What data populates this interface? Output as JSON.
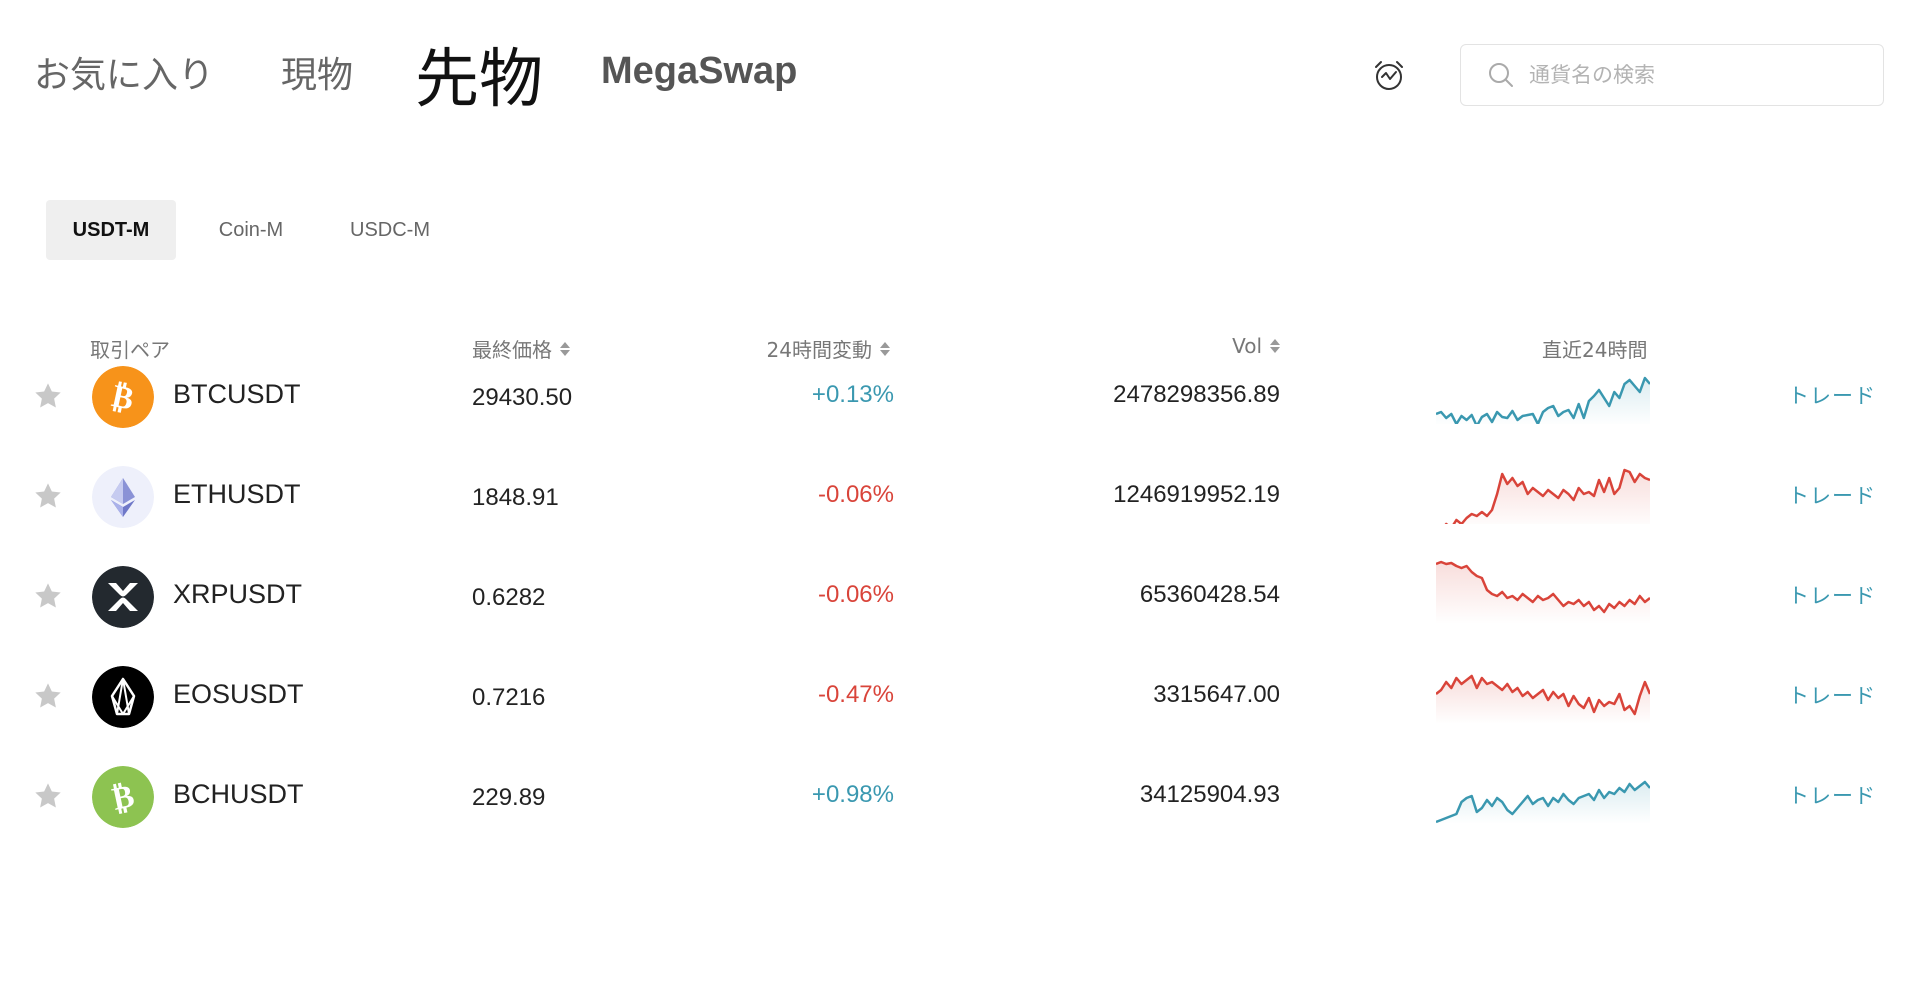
{
  "nav": {
    "tabs": [
      "お気に入り",
      "現物",
      "先物",
      "MegaSwap"
    ],
    "active": "先物"
  },
  "search": {
    "placeholder": "通貨名の検索"
  },
  "subtabs": [
    "USDT-M",
    "Coin-M",
    "USDC-M"
  ],
  "active_subtab": "USDT-M",
  "columns": {
    "pair": "取引ペア",
    "price": "最終価格",
    "change": "24時間変動",
    "vol": "Vol",
    "spark": "直近24時間"
  },
  "rows": [
    {
      "pair": "BTCUSDT",
      "price": "29430.50",
      "change": "+0.13%",
      "direction": "up",
      "vol": "2478298356.89",
      "action": "トレード",
      "icon": "bitcoin-icon",
      "icon_bg": "#f7931a",
      "spark": [
        60,
        58,
        64,
        60,
        70,
        62,
        66,
        61,
        72,
        63,
        60,
        68,
        58,
        63,
        64,
        57,
        66,
        62,
        61,
        60,
        70,
        58,
        54,
        52,
        62,
        58,
        56,
        64,
        50,
        64,
        47,
        42,
        36,
        44,
        52,
        38,
        44,
        30,
        26,
        32,
        38,
        24,
        30
      ]
    },
    {
      "pair": "ETHUSDT",
      "price": "1848.91",
      "change": "-0.06%",
      "direction": "down",
      "vol": "1246919952.19",
      "action": "トレード",
      "icon": "ethereum-icon",
      "icon_bg": "#eef0fb",
      "spark": [
        72,
        76,
        70,
        74,
        66,
        70,
        64,
        60,
        62,
        58,
        62,
        56,
        40,
        20,
        30,
        24,
        32,
        28,
        40,
        34,
        38,
        42,
        36,
        40,
        44,
        36,
        40,
        46,
        34,
        40,
        38,
        42,
        26,
        38,
        24,
        40,
        34,
        16,
        18,
        28,
        20,
        24,
        26
      ]
    },
    {
      "pair": "XRPUSDT",
      "price": "0.6282",
      "change": "-0.06%",
      "direction": "down",
      "vol": "65360428.54",
      "action": "トレード",
      "icon": "xrp-icon",
      "icon_bg": "#23292f",
      "spark": [
        10,
        8,
        10,
        9,
        12,
        14,
        12,
        18,
        22,
        24,
        36,
        40,
        42,
        38,
        44,
        42,
        46,
        40,
        44,
        48,
        42,
        46,
        44,
        40,
        46,
        52,
        48,
        50,
        46,
        52,
        48,
        56,
        52,
        58,
        50,
        54,
        48,
        52,
        46,
        50,
        42,
        48,
        44
      ]
    },
    {
      "pair": "EOSUSDT",
      "price": "0.7216",
      "change": "-0.47%",
      "direction": "down",
      "vol": "3315647.00",
      "action": "トレード",
      "icon": "eos-icon",
      "icon_bg": "#000000",
      "spark": [
        40,
        36,
        28,
        34,
        24,
        30,
        26,
        22,
        34,
        24,
        30,
        28,
        32,
        36,
        30,
        38,
        34,
        42,
        38,
        44,
        40,
        36,
        46,
        38,
        44,
        40,
        52,
        42,
        50,
        54,
        44,
        58,
        46,
        52,
        48,
        50,
        40,
        56,
        52,
        60,
        42,
        28,
        40
      ]
    },
    {
      "pair": "BCHUSDT",
      "price": "229.89",
      "change": "+0.98%",
      "direction": "up",
      "vol": "34125904.93",
      "action": "トレード",
      "icon": "bitcoin-cash-icon",
      "icon_bg": "#8dc351",
      "spark": [
        68,
        66,
        64,
        62,
        60,
        48,
        44,
        42,
        58,
        54,
        46,
        52,
        44,
        48,
        56,
        60,
        54,
        48,
        42,
        50,
        46,
        44,
        52,
        44,
        48,
        40,
        46,
        50,
        44,
        42,
        40,
        46,
        36,
        44,
        38,
        40,
        34,
        38,
        30,
        36,
        32,
        28,
        34
      ]
    }
  ],
  "colors": {
    "up": "#3a98b0",
    "down": "#d9443a",
    "accent": "#3a98b0"
  }
}
